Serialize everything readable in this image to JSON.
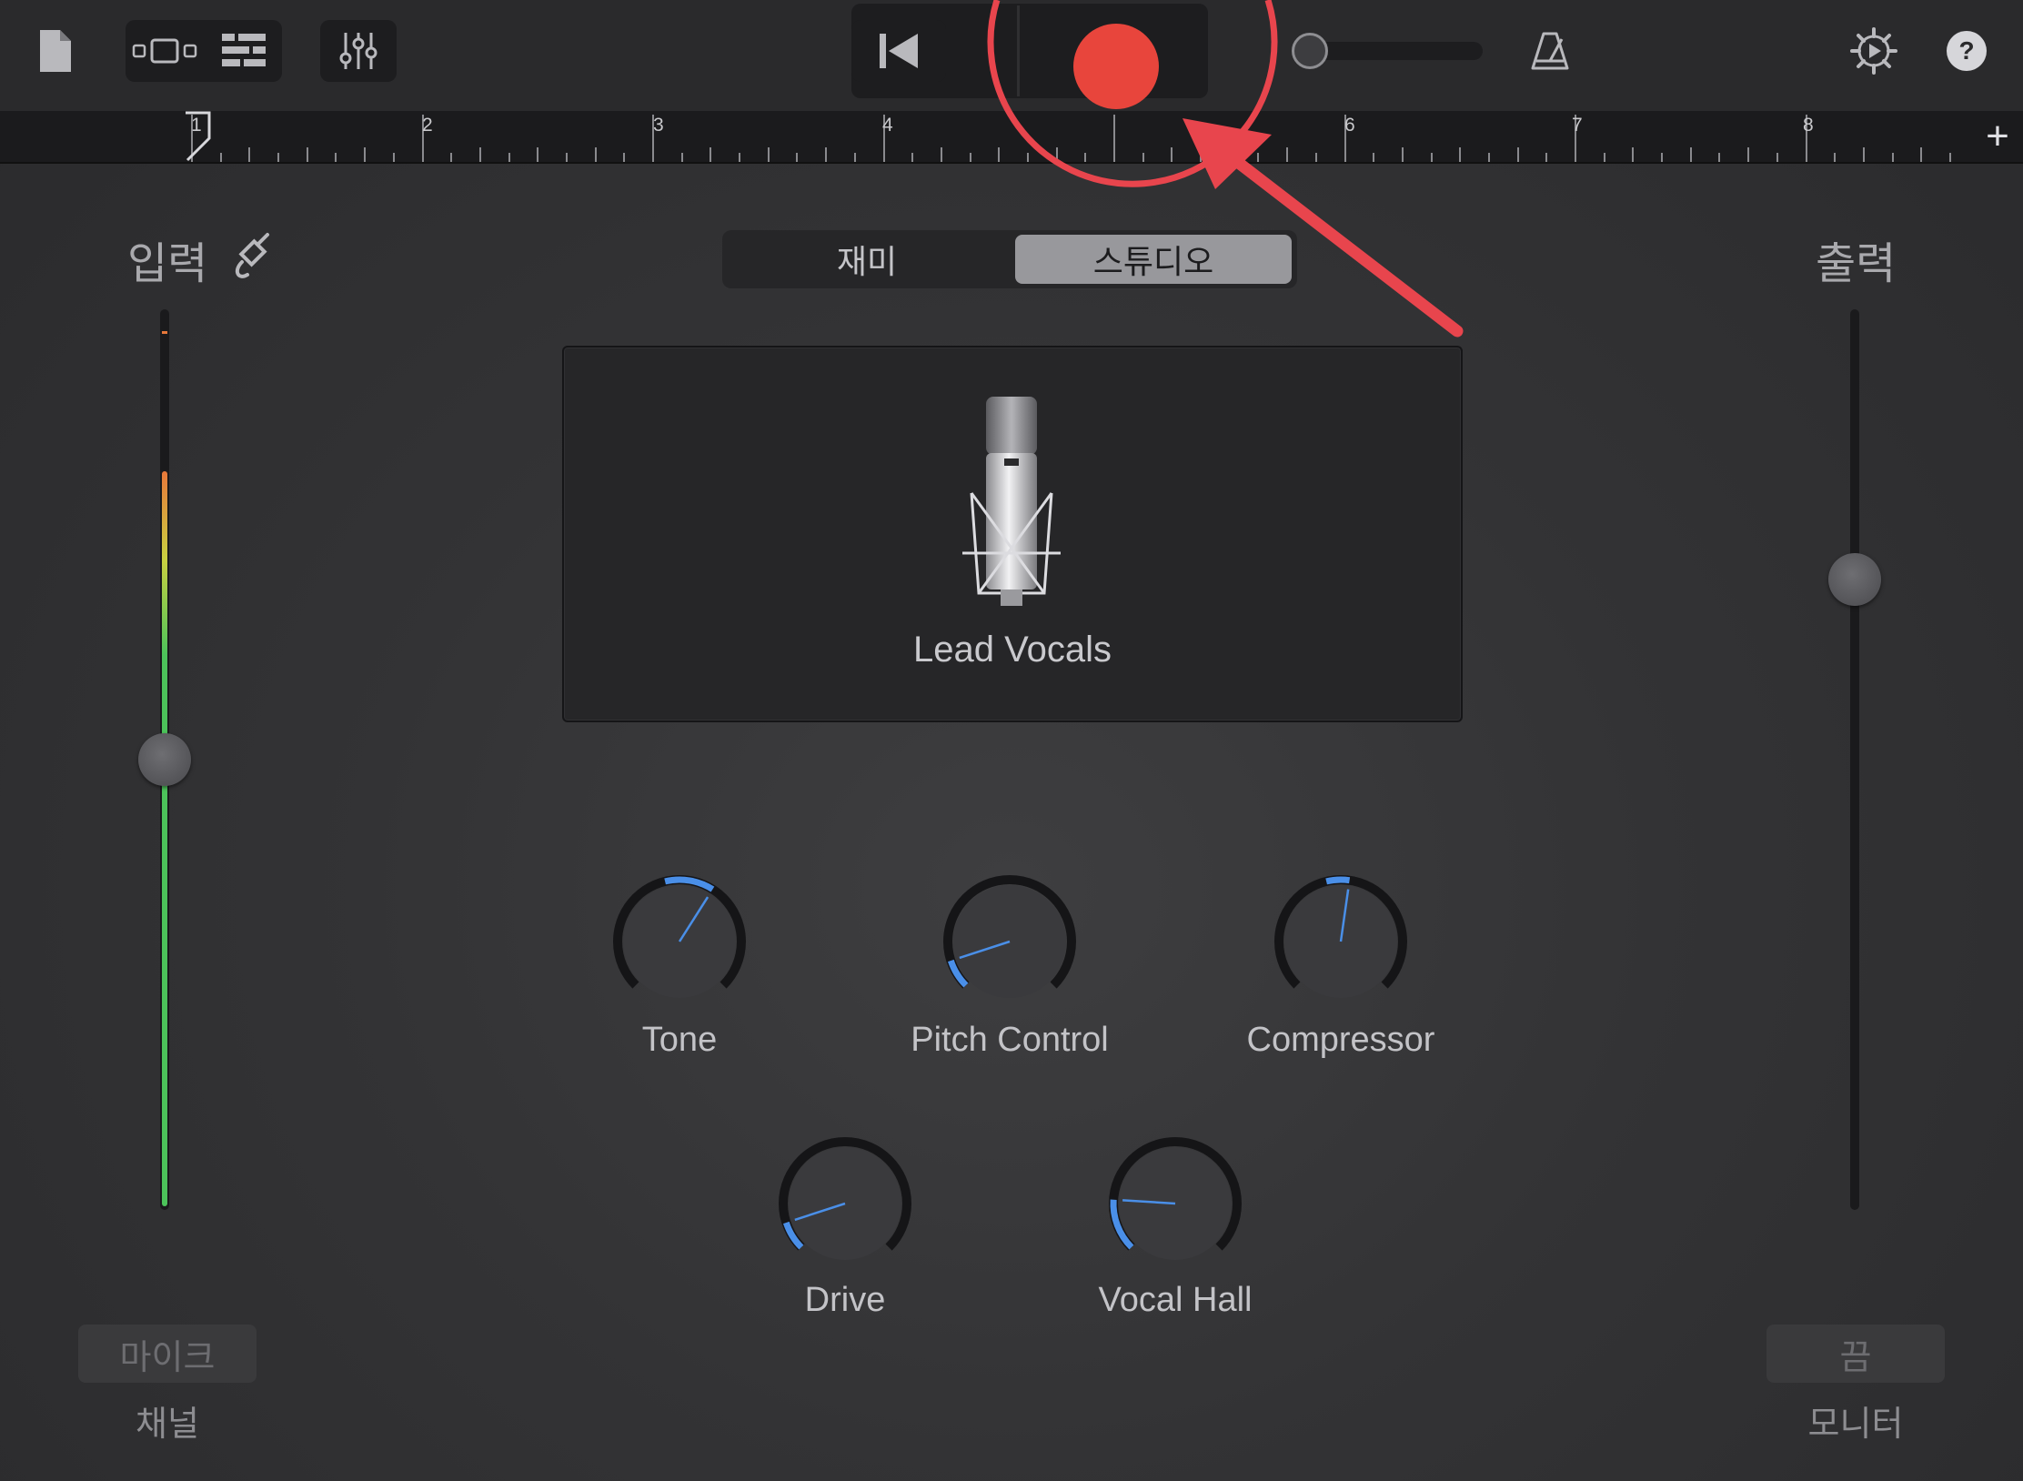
{
  "toolbar": {
    "icons": [
      "document-icon",
      "tracks-view-icon",
      "browser-list-icon",
      "mixer-icon",
      "rewind-icon",
      "record-icon",
      "volume-slider",
      "metronome-icon",
      "settings-icon",
      "help-icon"
    ],
    "help_glyph": "?",
    "master_volume": 0.0
  },
  "ruler": {
    "bars": [
      "1",
      "2",
      "3",
      "4",
      "6",
      "7",
      "8"
    ],
    "add_glyph": "+"
  },
  "mode": {
    "options": [
      "재미",
      "스튜디오"
    ],
    "selected": "스튜디오"
  },
  "input": {
    "title": "입력",
    "level": 0.5,
    "meter_level": 0.82,
    "channel_button": "마이크",
    "channel_caption": "채널"
  },
  "output": {
    "title": "출력",
    "level": 0.7,
    "monitor_button": "끔",
    "monitor_caption": "모니터"
  },
  "instrument": {
    "preset_name": "Lead Vocals",
    "icon": "microphone-icon"
  },
  "knobs": [
    {
      "label": "Tone",
      "value": 0.62
    },
    {
      "label": "Pitch Control",
      "value": 0.1
    },
    {
      "label": "Compressor",
      "value": 0.53
    },
    {
      "label": "Drive",
      "value": 0.1
    },
    {
      "label": "Vocal Hall",
      "value": 0.18
    }
  ],
  "colors": {
    "record": "#e8453c",
    "accent": "#4a8fe8",
    "annotation": "#e8454d",
    "meter_green": "#4cc35a",
    "meter_orange": "#e8783a"
  }
}
